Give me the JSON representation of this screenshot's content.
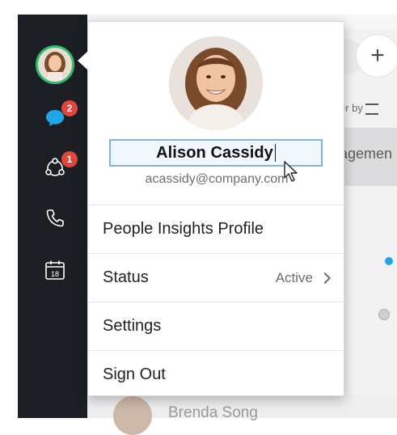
{
  "profile": {
    "name": "Alison Cassidy",
    "email": "acassidy@company.com"
  },
  "menu": {
    "items": [
      {
        "label": "People Insights Profile"
      },
      {
        "label": "Status",
        "value": "Active"
      },
      {
        "label": "Settings"
      },
      {
        "label": "Sign Out"
      }
    ]
  },
  "sidebar": {
    "chat_badge": "2",
    "meetings_badge": "1",
    "calendar_day": "18"
  },
  "background": {
    "sort_label": "er by",
    "panel_text": "agemen",
    "list_name": "Brenda Song"
  },
  "colors": {
    "sidebar_bg": "#1b1f24",
    "presence_active": "#2fbf71",
    "badge_red": "#e0463d",
    "chat_blue": "#1fa6e8",
    "name_highlight_border": "#7fb1e1"
  },
  "icons": {
    "chat": "chat-bubble-icon",
    "meetings": "meetings-network-icon",
    "calls": "phone-icon",
    "calendar": "calendar-icon",
    "status_chevron": "chevron-right-icon",
    "new": "plus-icon",
    "filter": "filter-icon"
  }
}
